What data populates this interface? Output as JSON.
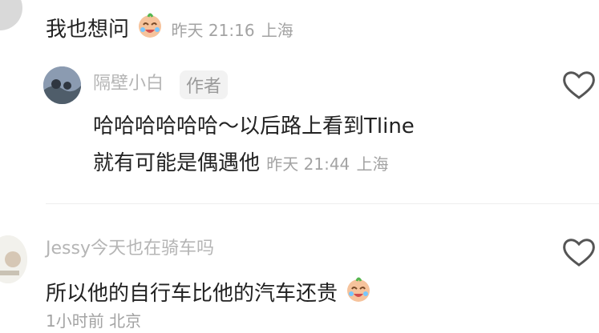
{
  "comments": [
    {
      "text": "我也想问",
      "time": "昨天 21:16",
      "location": "上海",
      "reaction_icon": "crying-laughing-emoji"
    },
    {
      "username": "隔壁小白",
      "badge": "作者",
      "line1": "哈哈哈哈哈哈～以后路上看到Tline",
      "line2": "就有可能是偶遇他",
      "time": "昨天 21:44",
      "location": "上海",
      "action_icon": "heart-outline-icon"
    },
    {
      "username": "Jessy今天也在骑车吗",
      "text": "所以他的自行车比他的汽车还贵",
      "time": "1小时前",
      "location": "北京",
      "action_icon": "heart-outline-icon",
      "reaction_icon": "crying-laughing-emoji"
    }
  ],
  "colors": {
    "text": "#222222",
    "meta": "#a3a3a3",
    "divider": "#eeeeee",
    "icon": "#555555"
  }
}
